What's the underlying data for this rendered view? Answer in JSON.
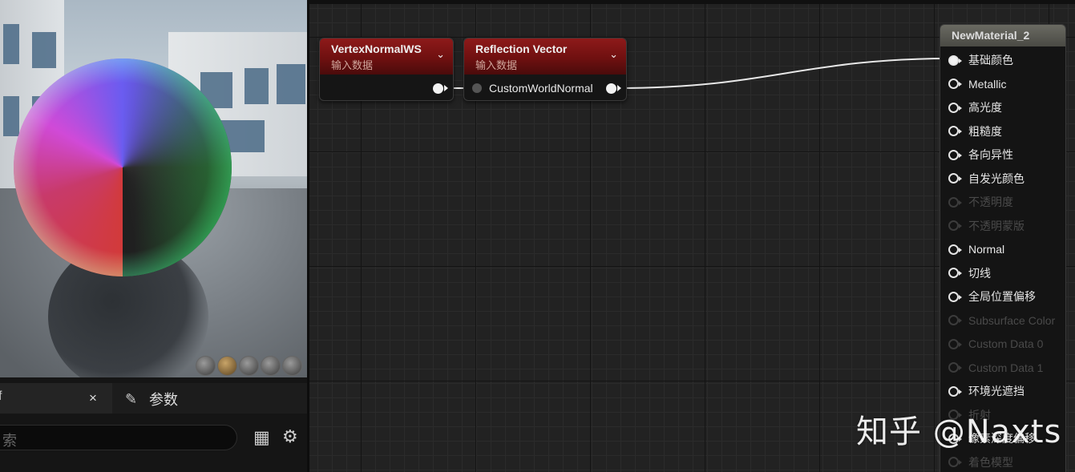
{
  "left_panel": {
    "viewport_icons": [
      "cylinder-icon",
      "sphere-icon",
      "plane-icon",
      "cube-icon",
      "custom-mesh-icon"
    ],
    "details_tab_fragment": "f",
    "close_glyph": "×",
    "params_tab_label": "参数",
    "search_fragment": "索",
    "bottom_fragment": "…"
  },
  "graph": {
    "nodes": [
      {
        "title": "VertexNormalWS",
        "subtitle": "输入数据",
        "collapse_glyph": "⌄"
      },
      {
        "title": "Reflection Vector",
        "subtitle": "输入数据",
        "collapse_glyph": "⌄",
        "input_label": "CustomWorldNormal"
      }
    ],
    "material": {
      "title": "NewMaterial_2",
      "pins": [
        {
          "label": "基础颜色",
          "state": "connected"
        },
        {
          "label": "Metallic",
          "state": "on"
        },
        {
          "label": "高光度",
          "state": "on"
        },
        {
          "label": "粗糙度",
          "state": "on"
        },
        {
          "label": "各向异性",
          "state": "on"
        },
        {
          "label": "自发光颜色",
          "state": "on"
        },
        {
          "label": "不透明度",
          "state": "off"
        },
        {
          "label": "不透明蒙版",
          "state": "off"
        },
        {
          "label": "Normal",
          "state": "on"
        },
        {
          "label": "切线",
          "state": "on"
        },
        {
          "label": "全局位置偏移",
          "state": "on"
        },
        {
          "label": "Subsurface Color",
          "state": "off"
        },
        {
          "label": "Custom Data 0",
          "state": "off"
        },
        {
          "label": "Custom Data 1",
          "state": "off"
        },
        {
          "label": "环境光遮挡",
          "state": "on"
        },
        {
          "label": "折射",
          "state": "off"
        },
        {
          "label": "像素深度偏移",
          "state": "on"
        },
        {
          "label": "着色模型",
          "state": "off"
        }
      ]
    },
    "header_accent": "#8e1a1a",
    "material_header_color": "#5a5a52"
  },
  "watermark": "知乎 @Naxts"
}
